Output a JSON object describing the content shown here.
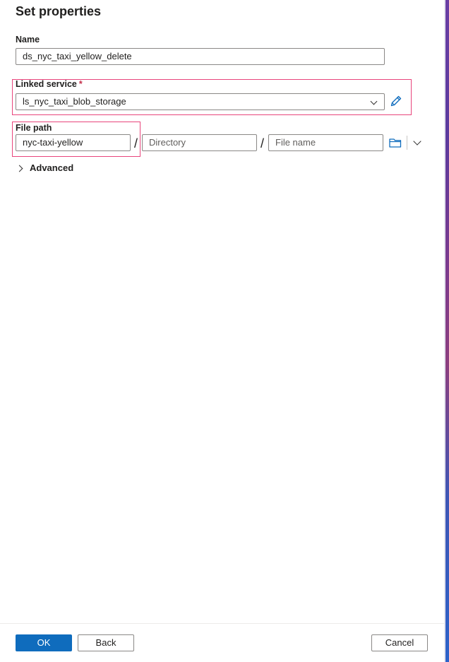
{
  "title": "Set properties",
  "name": {
    "label": "Name",
    "value": "ds_nyc_taxi_yellow_delete"
  },
  "linked_service": {
    "label": "Linked service",
    "required_marker": "*",
    "value": "ls_nyc_taxi_blob_storage"
  },
  "file_path": {
    "label": "File path",
    "container_value": "nyc-taxi-yellow",
    "separator": "/",
    "directory_placeholder": "Directory",
    "file_name_placeholder": "File name"
  },
  "advanced": {
    "label": "Advanced"
  },
  "footer": {
    "ok_label": "OK",
    "back_label": "Back",
    "cancel_label": "Cancel"
  },
  "colors": {
    "accent": "#0f6cbd",
    "highlight_box": "#e8457c",
    "required": "#c4314b"
  },
  "icons": {
    "edit": "pencil-icon",
    "browse": "folder-icon",
    "expand": "chevron-down-icon",
    "advanced_toggle": "chevron-right-icon"
  }
}
